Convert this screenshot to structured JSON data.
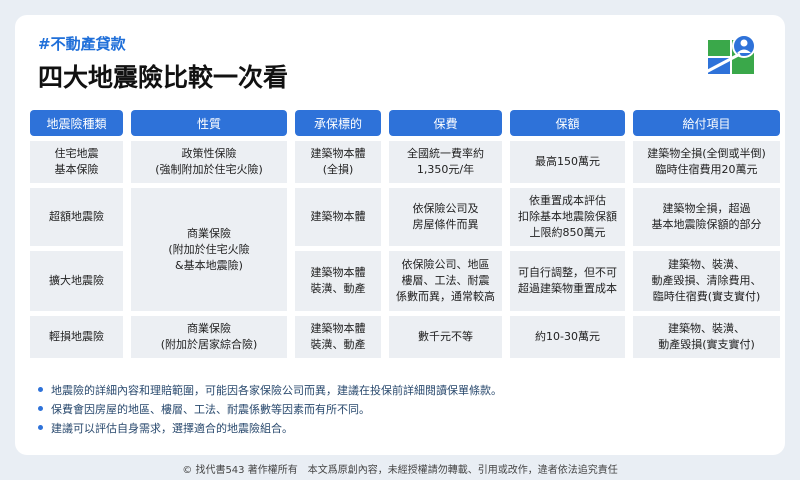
{
  "header": {
    "tag": "#不動產貸款",
    "title": "四大地震險比較一次看"
  },
  "table": {
    "headers": [
      "地震險種類",
      "性質",
      "承保標的",
      "保費",
      "保額",
      "給付項目"
    ],
    "rows": [
      {
        "type": "住宅地震\n基本保險",
        "nature": "政策性保險\n(強制附加於住宅火險)",
        "subject": "建築物本體\n(全損)",
        "premium": "全國統一費率約\n1,350元/年",
        "coverage": "最高150萬元",
        "payout": "建築物全損(全倒或半倒)\n臨時住宿費用20萬元"
      },
      {
        "type": "超額地震險",
        "subject": "建築物本體",
        "premium": "依保險公司及\n房屋條件而異",
        "coverage": "依重置成本評估\n扣除基本地震險保額\n上限約850萬元",
        "payout": "建築物全損，超過\n基本地震險保額的部分"
      },
      {
        "type": "擴大地震險",
        "subject": "建築物本體\n裝潢、動產",
        "premium": "依保險公司、地區\n樓層、工法、耐震\n係數而異，通常較高",
        "coverage": "可自行調整，但不可\n超過建築物重置成本",
        "payout": "建築物、裝潢、\n動產毀損、清除費用、\n臨時住宿費(實支實付)"
      },
      {
        "type": "輕損地震險",
        "nature": "商業保險\n(附加於居家綜合險)",
        "subject": "建築物本體\n裝潢、動產",
        "premium": "數千元不等",
        "coverage": "約10-30萬元",
        "payout": "建築物、裝潢、\n動產毀損(實支實付)"
      }
    ],
    "merged_nature": "商業保險\n(附加於住宅火險\n&基本地震險)"
  },
  "notes": [
    "地震險的詳細內容和理賠範圍，可能因各家保險公司而異，建議在投保前詳細閱讀保單條款。",
    "保費會因房屋的地區、樓層、工法、耐震係數等因素而有所不同。",
    "建議可以評估自身需求，選擇適合的地震險組合。"
  ],
  "footer": "© 找代書543 著作權所有　本文爲原創內容，未經授權請勿轉載、引用或改作，違者依法追究責任",
  "colors": {
    "accent": "#2e72d9",
    "cell_bg": "#eceff3",
    "page_bg": "#e9eef4"
  },
  "logo_icon": "house-agent-logo-icon"
}
